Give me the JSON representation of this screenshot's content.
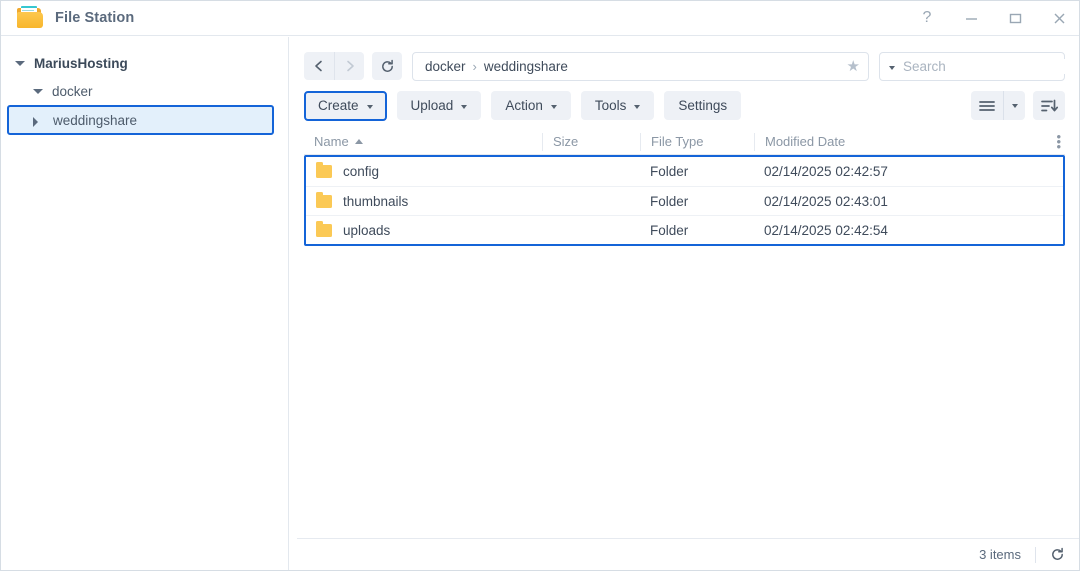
{
  "window": {
    "title": "File Station",
    "app_icon": "folder-icon",
    "controls": [
      {
        "name": "help",
        "glyph": "?"
      },
      {
        "name": "minimize",
        "glyph": "—"
      },
      {
        "name": "maximize",
        "glyph": "❐"
      },
      {
        "name": "close",
        "glyph": "✕"
      }
    ]
  },
  "sidebar": {
    "tree": [
      {
        "label": "MariusHosting",
        "level": 0,
        "expanded": true,
        "selected": false
      },
      {
        "label": "docker",
        "level": 1,
        "expanded": true,
        "selected": false
      },
      {
        "label": "weddingshare",
        "level": 2,
        "expanded": false,
        "selected": true
      }
    ]
  },
  "nav": {
    "back_icon": "chevron-left-icon",
    "forward_icon": "chevron-right-icon",
    "refresh_icon": "refresh-icon",
    "breadcrumb": [
      "docker",
      "weddingshare"
    ],
    "separator": "›",
    "favorite_icon": "star-icon"
  },
  "search": {
    "icon": "search-icon",
    "value": "",
    "placeholder": "Search"
  },
  "toolbar": {
    "buttons": [
      {
        "label": "Create",
        "dropdown": true,
        "highlighted": true
      },
      {
        "label": "Upload",
        "dropdown": true,
        "highlighted": false
      },
      {
        "label": "Action",
        "dropdown": true,
        "highlighted": false
      },
      {
        "label": "Tools",
        "dropdown": true,
        "highlighted": false
      },
      {
        "label": "Settings",
        "dropdown": false,
        "highlighted": false
      }
    ],
    "view_list_icon": "list-view-icon",
    "view_dropdown_icon": "chevron-down-icon",
    "sort_icon": "sort-descending-icon"
  },
  "file_list": {
    "columns": [
      {
        "key": "name",
        "label": "Name",
        "sorted": "asc"
      },
      {
        "key": "size",
        "label": "Size",
        "sorted": ""
      },
      {
        "key": "type",
        "label": "File Type",
        "sorted": ""
      },
      {
        "key": "date",
        "label": "Modified Date",
        "sorted": ""
      }
    ],
    "options_icon": "more-options-icon",
    "rows": [
      {
        "icon": "folder-icon",
        "name": "config",
        "size": "",
        "type": "Folder",
        "date": "02/14/2025 02:42:57"
      },
      {
        "icon": "folder-icon",
        "name": "thumbnails",
        "size": "",
        "type": "Folder",
        "date": "02/14/2025 02:43:01"
      },
      {
        "icon": "folder-icon",
        "name": "uploads",
        "size": "",
        "type": "Folder",
        "date": "02/14/2025 02:42:54"
      }
    ],
    "highlight_color": "#1464d8"
  },
  "status": {
    "items_count": "3 items",
    "refresh_icon": "refresh-icon"
  },
  "colors": {
    "accent": "#1464d8",
    "button_bg": "#eef1f6",
    "selection_bg": "#e3f0fb",
    "folder_yellow": "#fbc955",
    "text": "#3f4b5b",
    "muted_text": "#8b97a5"
  }
}
